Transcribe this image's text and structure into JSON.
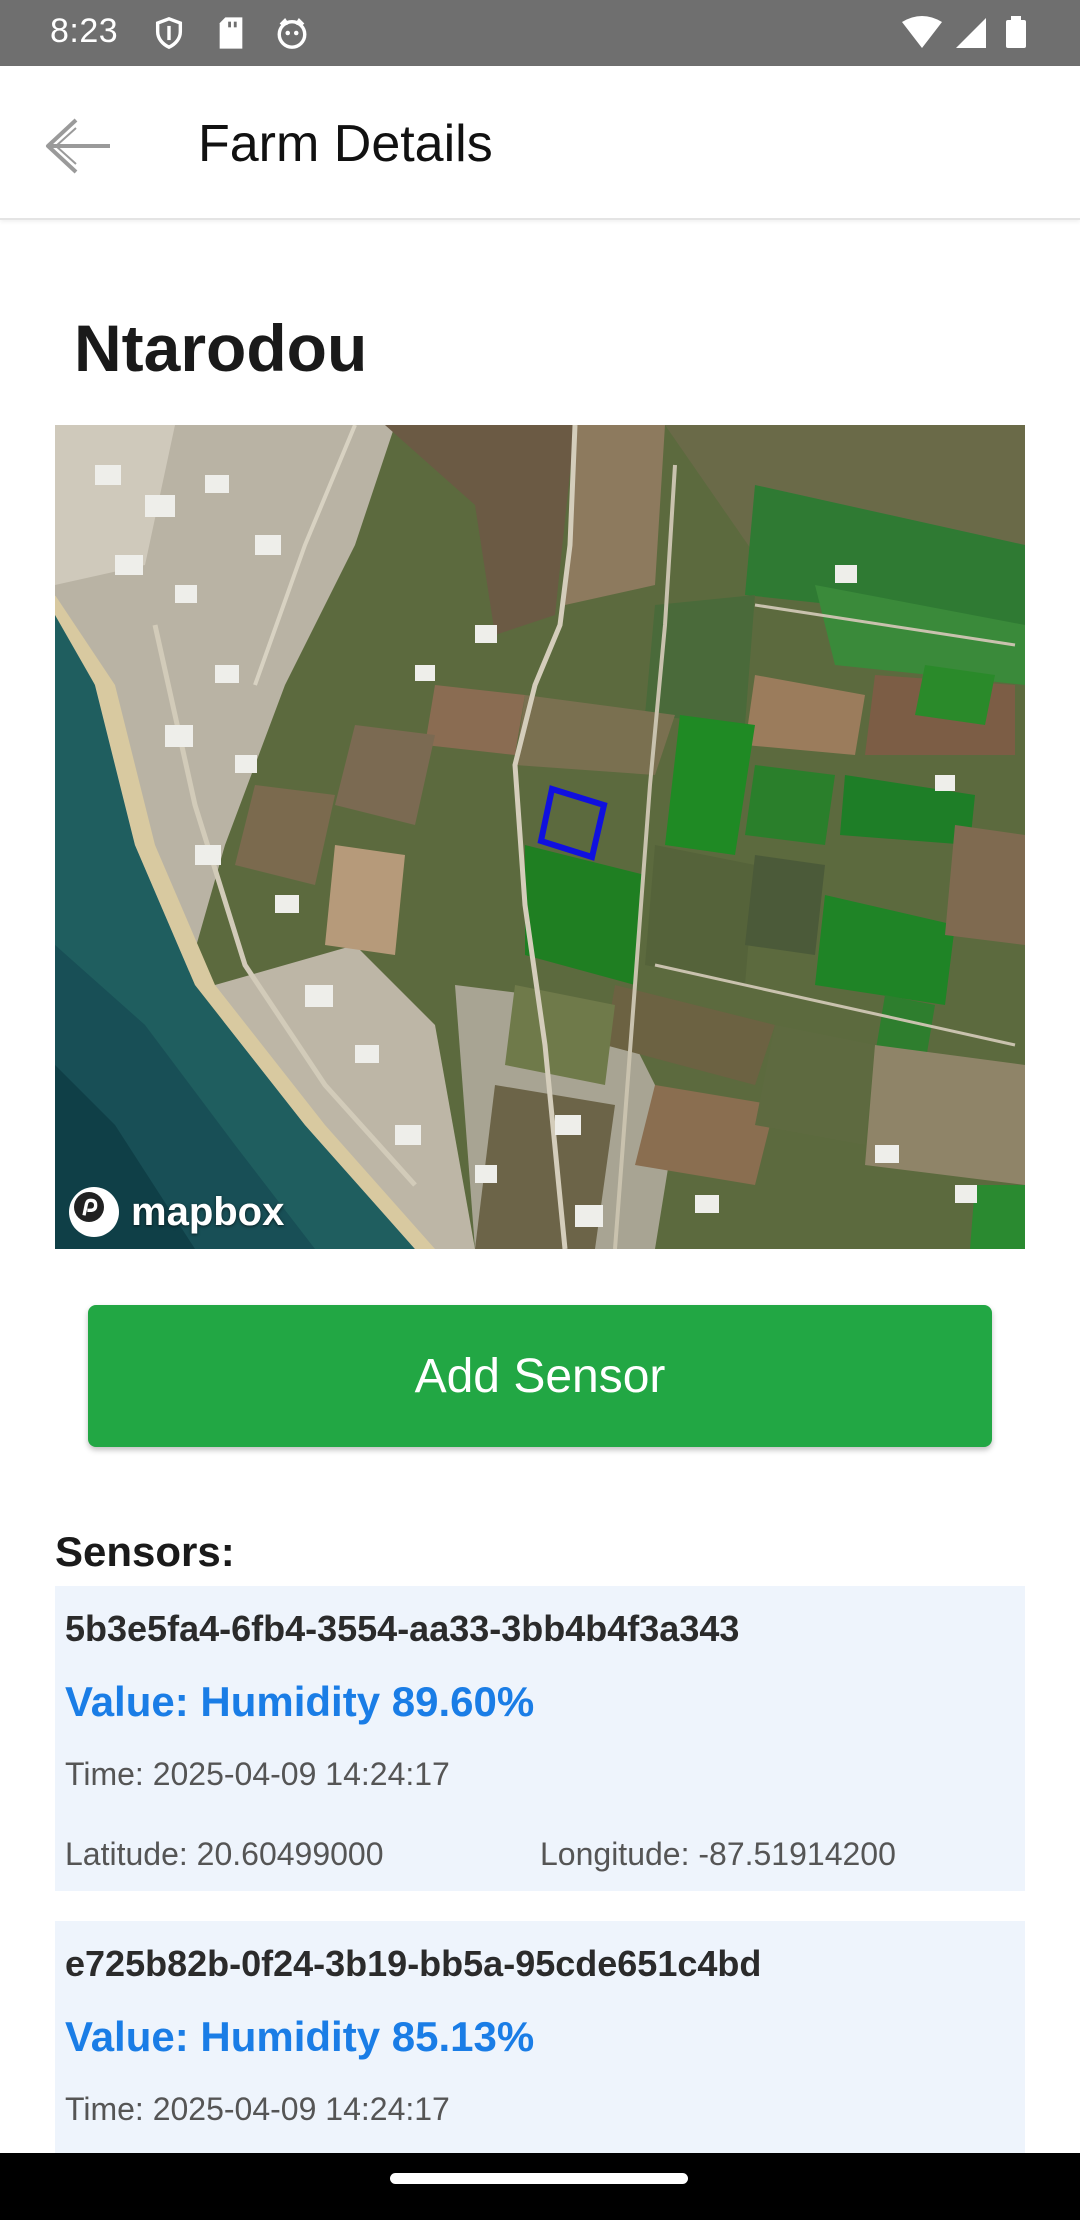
{
  "status_bar": {
    "time": "8:23",
    "left_icons": [
      "shield-icon",
      "sd-card-icon",
      "cat-face-icon"
    ],
    "right_icons": [
      "wifi-icon",
      "signal-icon",
      "battery-icon"
    ]
  },
  "app_bar": {
    "back_icon": "arrow-left-icon",
    "title": "Farm Details"
  },
  "farm": {
    "name": "Ntarodou"
  },
  "map": {
    "attribution": "mapbox",
    "boundary_color": "#1010e0"
  },
  "actions": {
    "add_sensor_label": "Add Sensor",
    "add_sensor_color": "#22a744"
  },
  "sensors": {
    "heading": "Sensors:",
    "items": [
      {
        "id": "5b3e5fa4-6fb4-3554-aa33-3bb4b4f3a343",
        "value": "Value: Humidity 89.60%",
        "time": "Time: 2025-04-09 14:24:17",
        "latitude": "Latitude: 20.60499000",
        "longitude": "Longitude: -87.51914200"
      },
      {
        "id": "e725b82b-0f24-3b19-bb5a-95cde651c4bd",
        "value": "Value: Humidity 85.13%",
        "time": "Time: 2025-04-09 14:24:17"
      }
    ]
  },
  "colors": {
    "value_text": "#1a7de6",
    "card_background": "#eef4fc"
  }
}
